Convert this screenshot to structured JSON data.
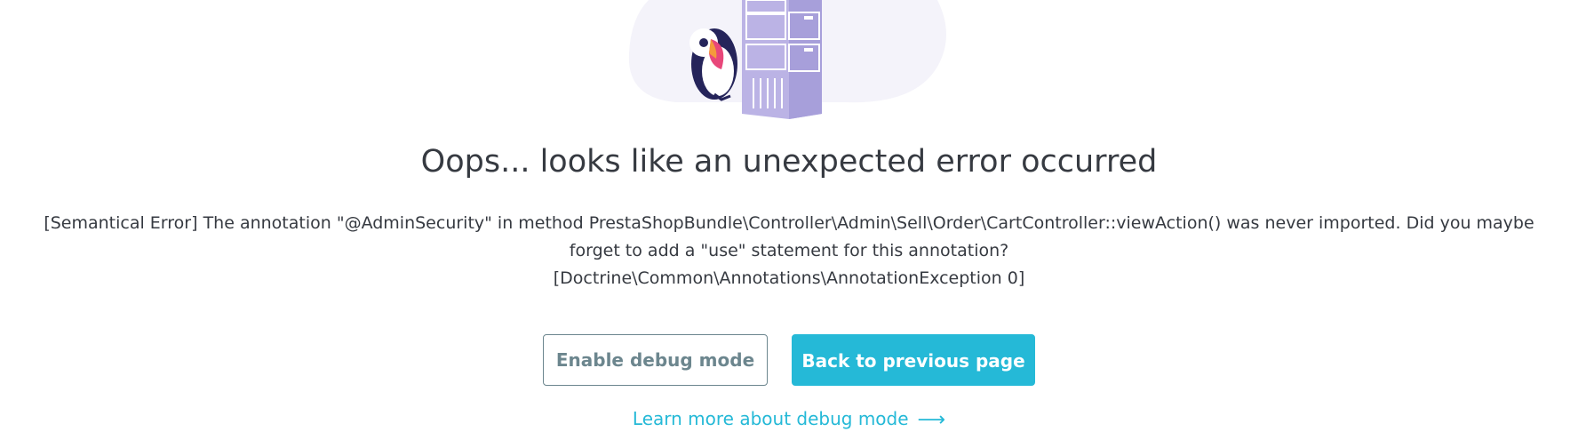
{
  "error_page": {
    "title": "Oops... looks like an unexpected error occurred",
    "message_lines": [
      "[Semantical Error] The annotation \"@AdminSecurity\" in method PrestaShopBundle\\Controller\\Admin\\Sell\\Order\\CartController::viewAction() was never imported. Did you maybe",
      "forget to add a \"use\" statement for this annotation?",
      "[Doctrine\\Common\\Annotations\\AnnotationException 0]"
    ],
    "buttons": {
      "debug_label": "Enable debug mode",
      "back_label": "Back to previous page"
    },
    "learn_more": {
      "label": "Learn more about debug mode",
      "arrow": "⟶"
    }
  },
  "illustration": {
    "icon": "puffin-with-server-icon"
  },
  "colors": {
    "primary": "#25b9d7",
    "text": "#363a41",
    "secondary": "#6c868e",
    "server": "#bbb3e5",
    "blob": "#f4f3fa"
  }
}
